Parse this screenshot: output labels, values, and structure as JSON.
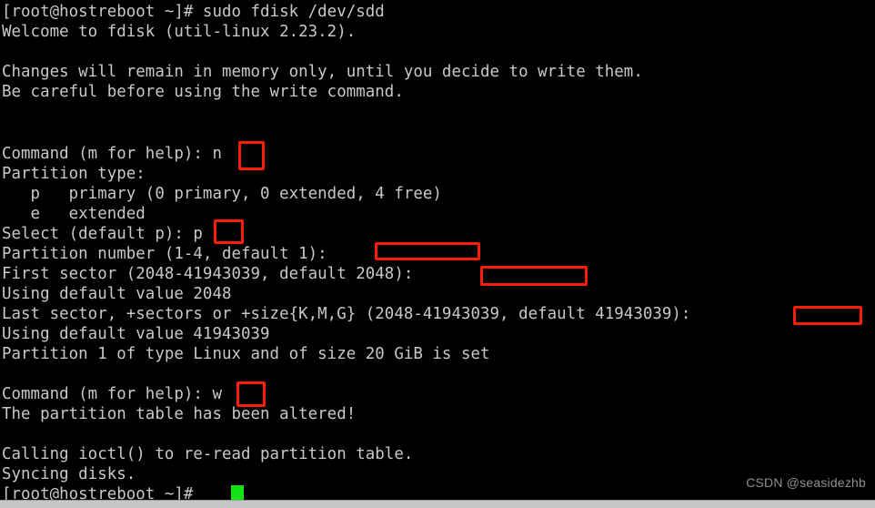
{
  "window": {
    "title": "root@hostreboot:~ — fdisk",
    "background_color": "#000000",
    "text_color": "#c8c8c8",
    "annotation_color": "#fc1c09",
    "cursor_color": "#13e313"
  },
  "terminal": {
    "lines": [
      {
        "id": "l0",
        "text": "[root@hostreboot ~]# sudo fdisk /dev/sdd"
      },
      {
        "id": "l1",
        "text": "Welcome to fdisk (util-linux 2.23.2)."
      },
      {
        "id": "l2",
        "text": ""
      },
      {
        "id": "l3",
        "text": "Changes will remain in memory only, until you decide to write them."
      },
      {
        "id": "l4",
        "text": "Be careful before using the write command."
      },
      {
        "id": "l5",
        "text": ""
      },
      {
        "id": "l6",
        "text": ""
      },
      {
        "id": "l7",
        "text": "Command (m for help): n"
      },
      {
        "id": "l8",
        "text": "Partition type:"
      },
      {
        "id": "l9",
        "text": "   p   primary (0 primary, 0 extended, 4 free)"
      },
      {
        "id": "l10",
        "text": "   e   extended"
      },
      {
        "id": "l11",
        "text": "Select (default p): p"
      },
      {
        "id": "l12",
        "text": "Partition number (1-4, default 1): "
      },
      {
        "id": "l13",
        "text": "First sector (2048-41943039, default 2048): "
      },
      {
        "id": "l14",
        "text": "Using default value 2048"
      },
      {
        "id": "l15",
        "text": "Last sector, +sectors or +size{K,M,G} (2048-41943039, default 41943039): "
      },
      {
        "id": "l16",
        "text": "Using default value 41943039"
      },
      {
        "id": "l17",
        "text": "Partition 1 of type Linux and of size 20 GiB is set"
      },
      {
        "id": "l18",
        "text": ""
      },
      {
        "id": "l19",
        "text": "Command (m for help): w"
      },
      {
        "id": "l20",
        "text": "The partition table has been altered!"
      },
      {
        "id": "l21",
        "text": ""
      },
      {
        "id": "l22",
        "text": "Calling ioctl() to re-read partition table."
      },
      {
        "id": "l23",
        "text": "Syncing disks."
      },
      {
        "id": "l24",
        "text": "[root@hostreboot ~]# "
      }
    ]
  },
  "annotations": [
    {
      "id": "a0",
      "label": "highlight-command-n",
      "value": "n"
    },
    {
      "id": "a1",
      "label": "highlight-select-p",
      "value": "p"
    },
    {
      "id": "a2",
      "label": "highlight-partition-number-input",
      "value": ""
    },
    {
      "id": "a3",
      "label": "highlight-first-sector-input",
      "value": ""
    },
    {
      "id": "a4",
      "label": "highlight-last-sector-input",
      "value": ""
    },
    {
      "id": "a5",
      "label": "highlight-command-w",
      "value": "w"
    }
  ],
  "command_values": {
    "device": "/dev/sdd",
    "fdisk_version": "util-linux 2.23.2",
    "partition_type_chosen": "p",
    "new_partition_key": "n",
    "write_key": "w",
    "sector_range_min": "2048",
    "sector_range_max": "41943039",
    "default_first_sector": "2048",
    "default_last_sector": "41943039",
    "partition_number_range": "1-4",
    "default_partition_number": "1",
    "partition_size": "20 GiB",
    "partition_fs_type": "Linux",
    "hostname": "hostreboot",
    "user": "root",
    "cwd": "~",
    "prompt_symbol": "#"
  },
  "watermark": {
    "text": "CSDN @seasidezhb"
  }
}
